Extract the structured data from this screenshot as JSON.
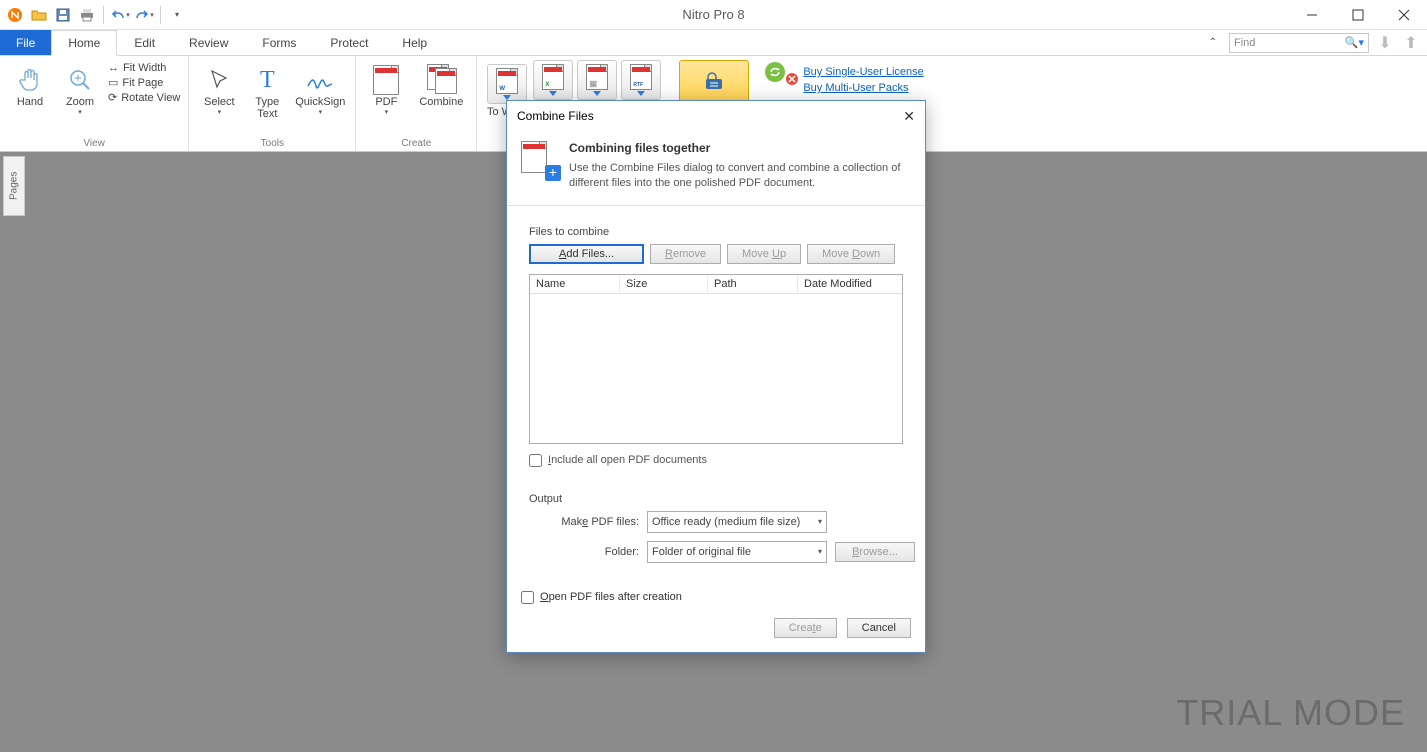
{
  "app": {
    "title": "Nitro Pro 8"
  },
  "qat": {
    "items": [
      "nitro",
      "open",
      "save",
      "print",
      "undo",
      "redo"
    ]
  },
  "window": {
    "min": "minimize",
    "max": "maximize",
    "close": "close"
  },
  "tabs": {
    "file": "File",
    "list": [
      "Home",
      "Edit",
      "Review",
      "Forms",
      "Protect",
      "Help"
    ],
    "active_index": 0,
    "find_placeholder": "Find"
  },
  "ribbon": {
    "view": {
      "label": "View",
      "hand": "Hand",
      "zoom": "Zoom",
      "fit_width": "Fit Width",
      "fit_page": "Fit Page",
      "rotate": "Rotate View"
    },
    "tools": {
      "label": "Tools",
      "select": "Select",
      "type_text": "Type Text",
      "quicksign": "QuickSign"
    },
    "create": {
      "label": "Create",
      "pdf": "PDF",
      "combine": "Combine"
    },
    "convert": {
      "to_word": "To Word",
      "to_excel_partial": "E"
    },
    "links": {
      "single": "Buy Single-User License",
      "multi": "Buy Multi-User Packs"
    }
  },
  "sidepanel": {
    "pages": "Pages"
  },
  "watermark": "TRIAL MODE",
  "dialog": {
    "title": "Combine Files",
    "heading": "Combining files together",
    "description": "Use the Combine Files dialog to convert and combine a collection of different files into the one polished PDF document.",
    "files_section": "Files to combine",
    "add_files": "Add Files...",
    "remove": "Remove",
    "move_up": "Move Up",
    "move_down": "Move Down",
    "col_name": "Name",
    "col_size": "Size",
    "col_path": "Path",
    "col_date": "Date Modified",
    "include_open": "Include all open PDF documents",
    "output_section": "Output",
    "make_pdf_label": "Make PDF files:",
    "make_pdf_value": "Office ready (medium file size)",
    "folder_label": "Folder:",
    "folder_value": "Folder of original file",
    "browse": "Browse...",
    "open_after": "Open PDF files after creation",
    "create": "Create",
    "cancel": "Cancel"
  }
}
